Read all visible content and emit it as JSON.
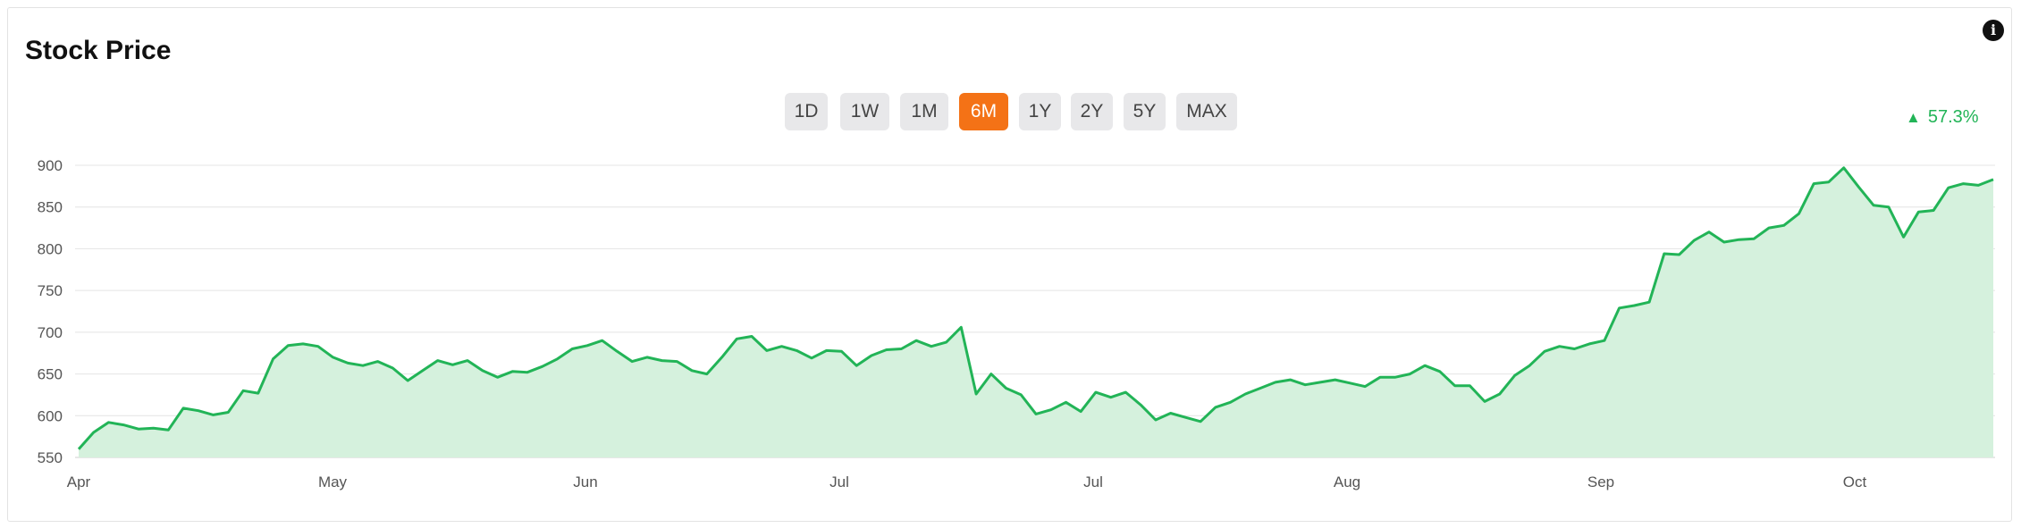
{
  "title": "Stock Price",
  "info_icon": "info-icon",
  "change": {
    "value": "57.3%",
    "direction": "up",
    "color": "#22b457"
  },
  "ranges": [
    "1D",
    "1W",
    "1M",
    "6M",
    "1Y",
    "2Y",
    "5Y",
    "MAX"
  ],
  "active_range": "6M",
  "colors": {
    "accent": "#f47216",
    "line": "#22b457",
    "fill": "#d5f1dd"
  },
  "chart_data": {
    "type": "area",
    "ylim": [
      550,
      900
    ],
    "yticks": [
      900,
      850,
      800,
      750,
      700,
      650,
      600,
      550
    ],
    "xlabels": [
      "Apr",
      "May",
      "Jun",
      "Jul",
      "Jul",
      "Aug",
      "Sep",
      "Oct"
    ],
    "grid": true,
    "values": [
      560,
      580,
      592,
      589,
      584,
      585,
      583,
      609,
      606,
      601,
      604,
      630,
      627,
      668,
      684,
      686,
      683,
      670,
      663,
      660,
      665,
      657,
      642,
      654,
      666,
      661,
      666,
      654,
      646,
      653,
      652,
      659,
      668,
      680,
      684,
      690,
      677,
      665,
      670,
      666,
      665,
      654,
      650,
      670,
      692,
      695,
      678,
      683,
      678,
      669,
      678,
      677,
      660,
      672,
      679,
      680,
      690,
      683,
      688,
      706,
      626,
      650,
      633,
      625,
      602,
      607,
      616,
      605,
      628,
      622,
      628,
      613,
      595,
      603,
      598,
      593,
      610,
      616,
      626,
      633,
      640,
      643,
      637,
      640,
      643,
      639,
      635,
      646,
      646,
      650,
      660,
      653,
      636,
      636,
      617,
      626,
      648,
      660,
      677,
      683,
      680,
      686,
      690,
      729,
      732,
      736,
      794,
      793,
      810,
      820,
      808,
      811,
      812,
      825,
      828,
      842,
      878,
      880,
      897,
      874,
      852,
      850,
      814,
      844,
      846,
      873,
      878,
      876,
      883
    ]
  }
}
